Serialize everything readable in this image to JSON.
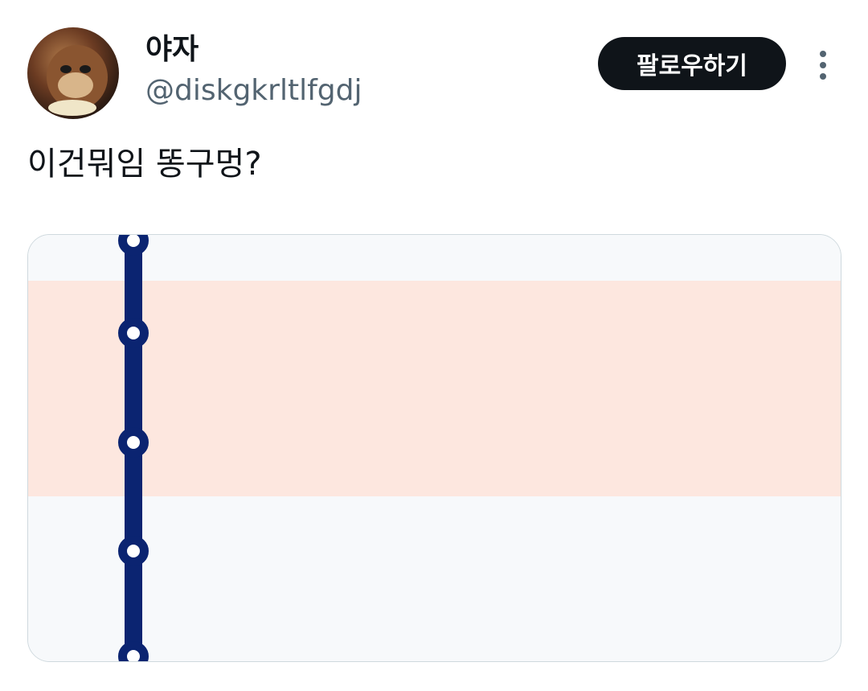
{
  "author": {
    "display_name": "야자",
    "handle": "@diskgkrltlfgdj"
  },
  "follow_button": {
    "label": "팔로우하기"
  },
  "more_icon": "more-vertical-icon",
  "tweet": {
    "text": "이건뭐임 똥구멍?"
  },
  "media": {
    "stations": [
      {
        "label": ""
      },
      {
        "label": ""
      },
      {
        "label": ""
      },
      {
        "label": ""
      },
      {
        "label": ""
      }
    ],
    "line_color": "#0b2471",
    "highlight_color": "#fde7df"
  }
}
